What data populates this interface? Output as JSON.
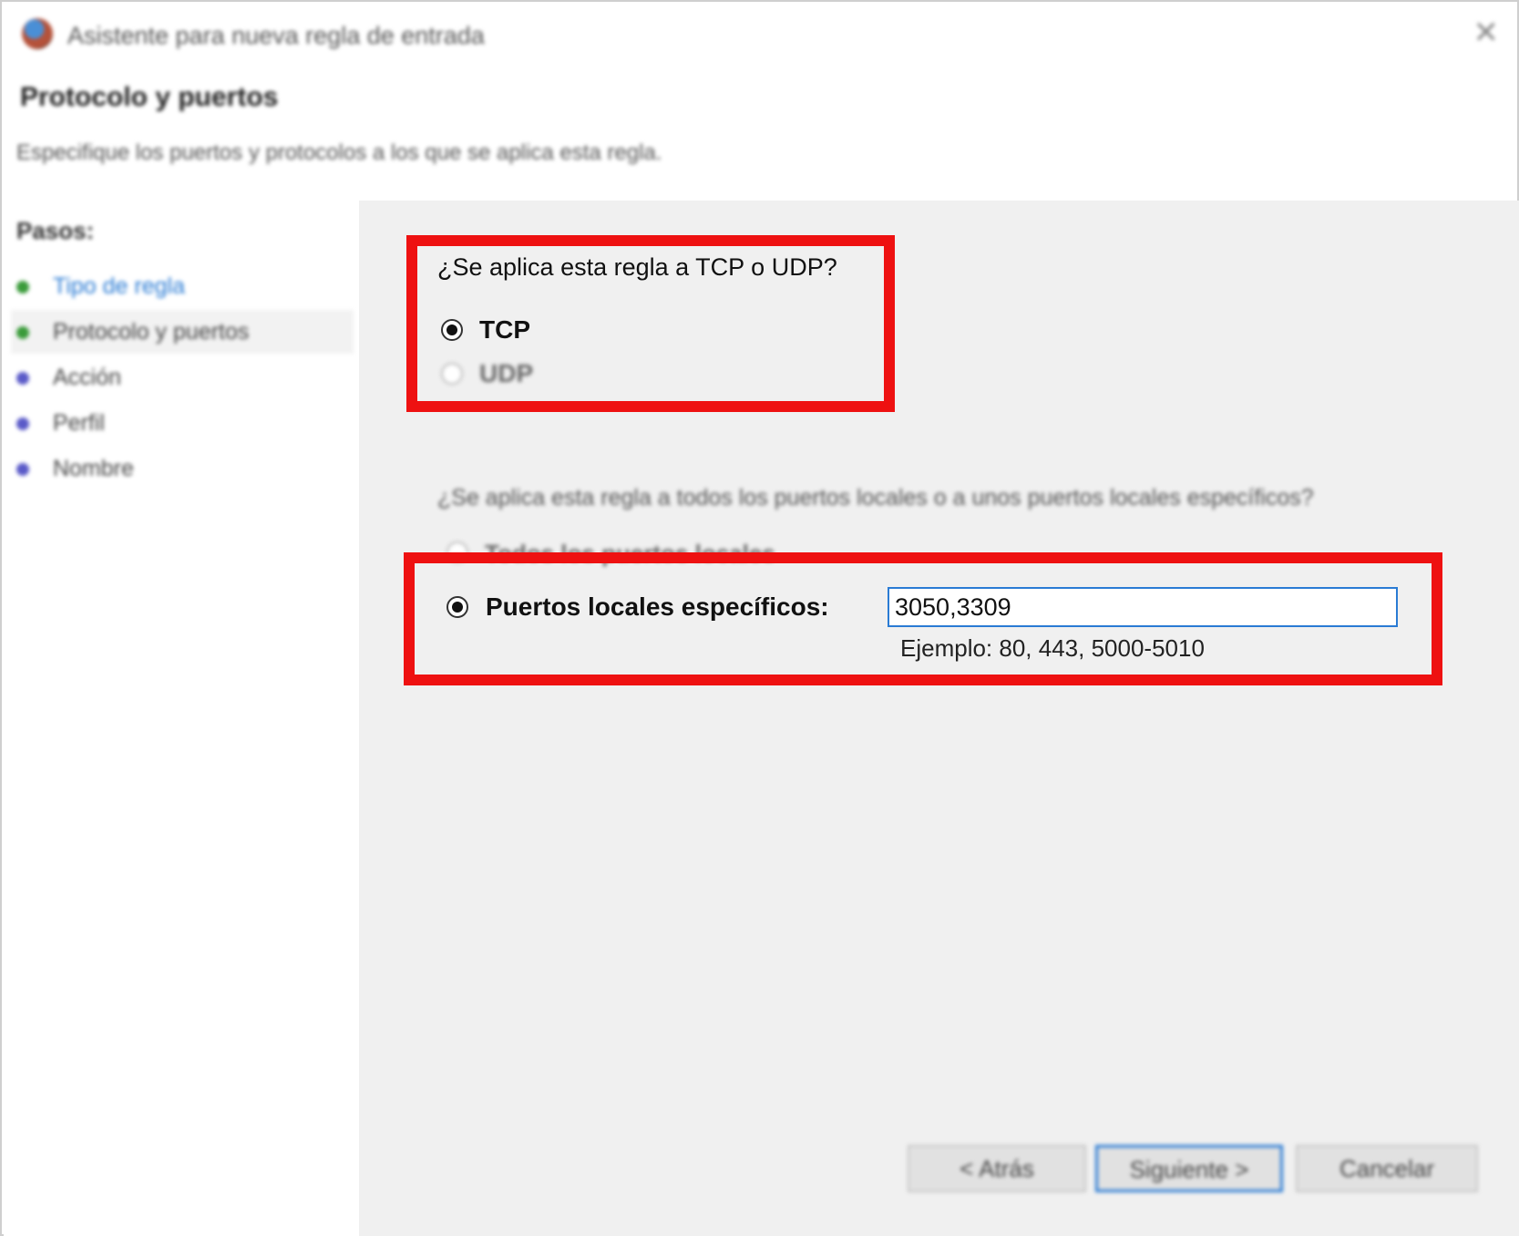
{
  "window": {
    "title": "Asistente para nueva regla de entrada",
    "header_title": "Protocolo y puertos",
    "header_subtitle": "Especifique los puertos y protocolos a los que se aplica esta regla."
  },
  "steps": {
    "title": "Pasos:",
    "items": [
      {
        "label": "Tipo de regla",
        "color": "#3a9b3a"
      },
      {
        "label": "Protocolo y puertos",
        "color": "#3a9b3a"
      },
      {
        "label": "Acción",
        "color": "#5a5ac8"
      },
      {
        "label": "Perfil",
        "color": "#5a5ac8"
      },
      {
        "label": "Nombre",
        "color": "#5a5ac8"
      }
    ]
  },
  "protocol": {
    "question": "¿Se aplica esta regla a TCP o UDP?",
    "tcp_label": "TCP",
    "udp_label": "UDP",
    "selected": "TCP"
  },
  "ports": {
    "question": "¿Se aplica esta regla a todos los puertos locales o a unos puertos locales específicos?",
    "all_label": "Todos los puertos locales",
    "specific_label": "Puertos locales específicos:",
    "value": "3050,3309",
    "example": "Ejemplo: 80, 443, 5000-5010",
    "selected": "specific"
  },
  "buttons": {
    "back": "< Atrás",
    "next": "Siguiente >",
    "cancel": "Cancelar"
  },
  "colors": {
    "highlight": "#ee1111",
    "accent": "#2a7bd4"
  }
}
